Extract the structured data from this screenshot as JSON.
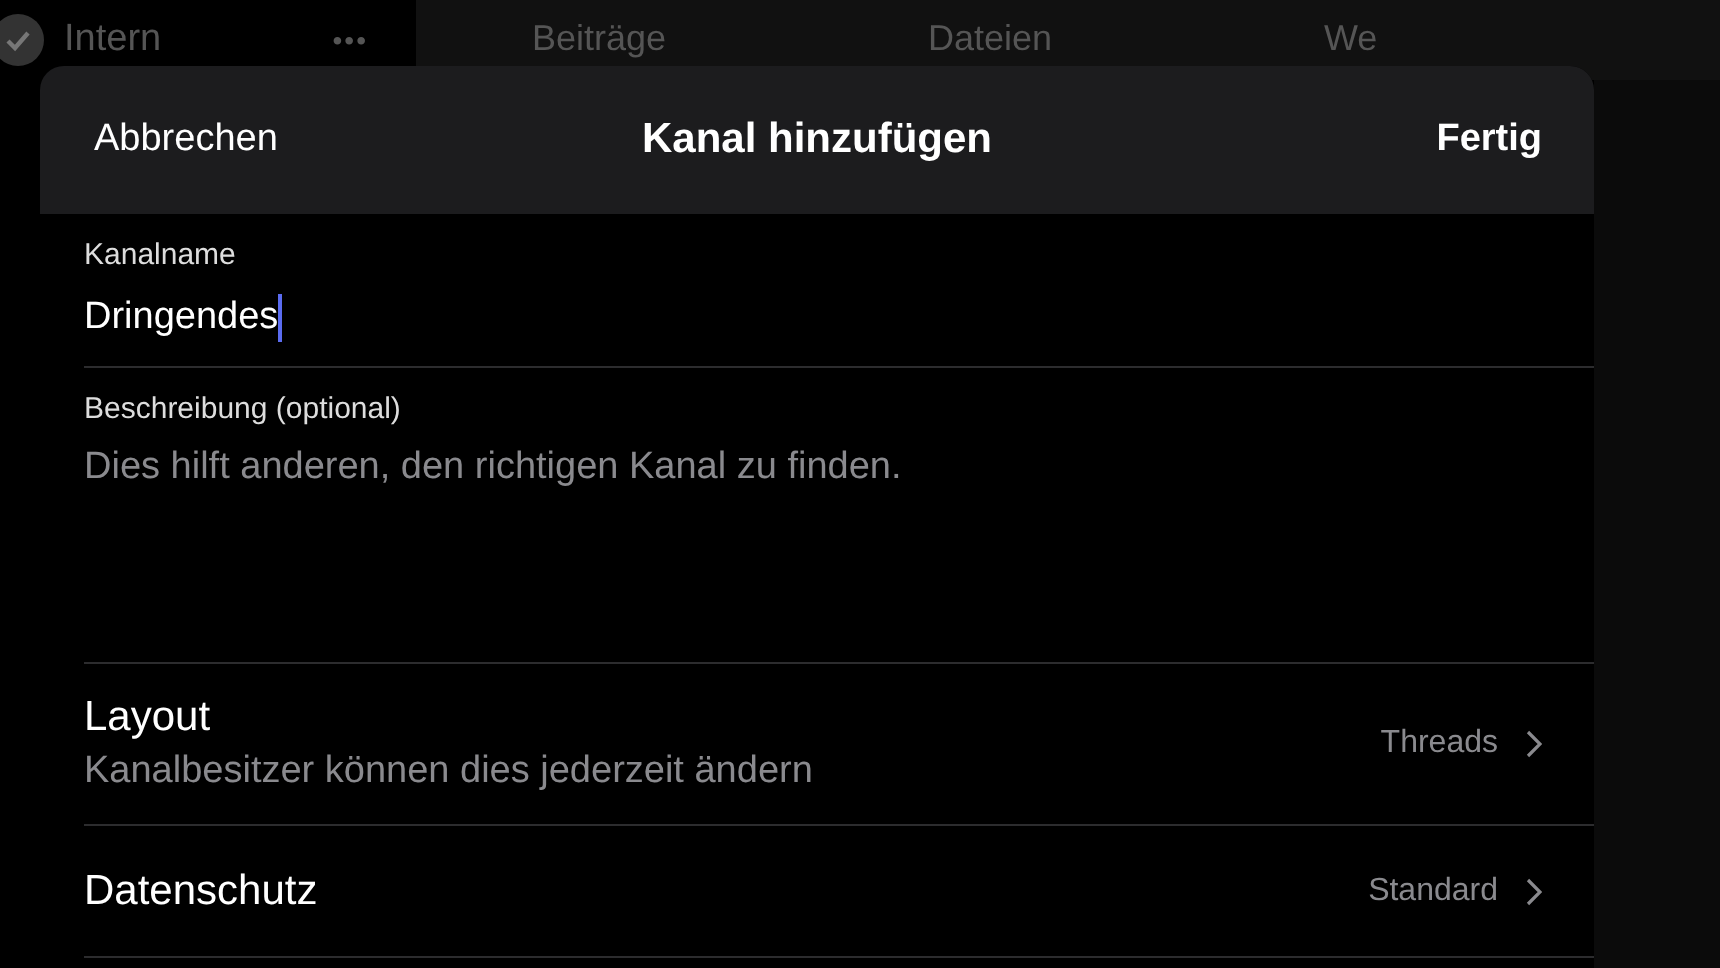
{
  "background": {
    "channel": "Intern",
    "more": "•••",
    "tabs": [
      {
        "label": "Beiträge",
        "selected": false
      },
      {
        "label": "Dateien",
        "selected": false
      },
      {
        "label": "We",
        "selected": false
      }
    ]
  },
  "dialog": {
    "cancel": "Abbrechen",
    "title": "Kanal hinzufügen",
    "done": "Fertig",
    "name_field": {
      "label": "Kanalname",
      "value": "Dringendes",
      "focused": true
    },
    "description_field": {
      "label": "Beschreibung (optional)",
      "placeholder": "Dies hilft anderen, den richtigen Kanal zu finden."
    },
    "rows": [
      {
        "title": "Layout",
        "subtitle": "Kanalbesitzer können dies jederzeit ändern",
        "value": "Threads"
      },
      {
        "title": "Datenschutz",
        "value": "Standard"
      }
    ]
  }
}
